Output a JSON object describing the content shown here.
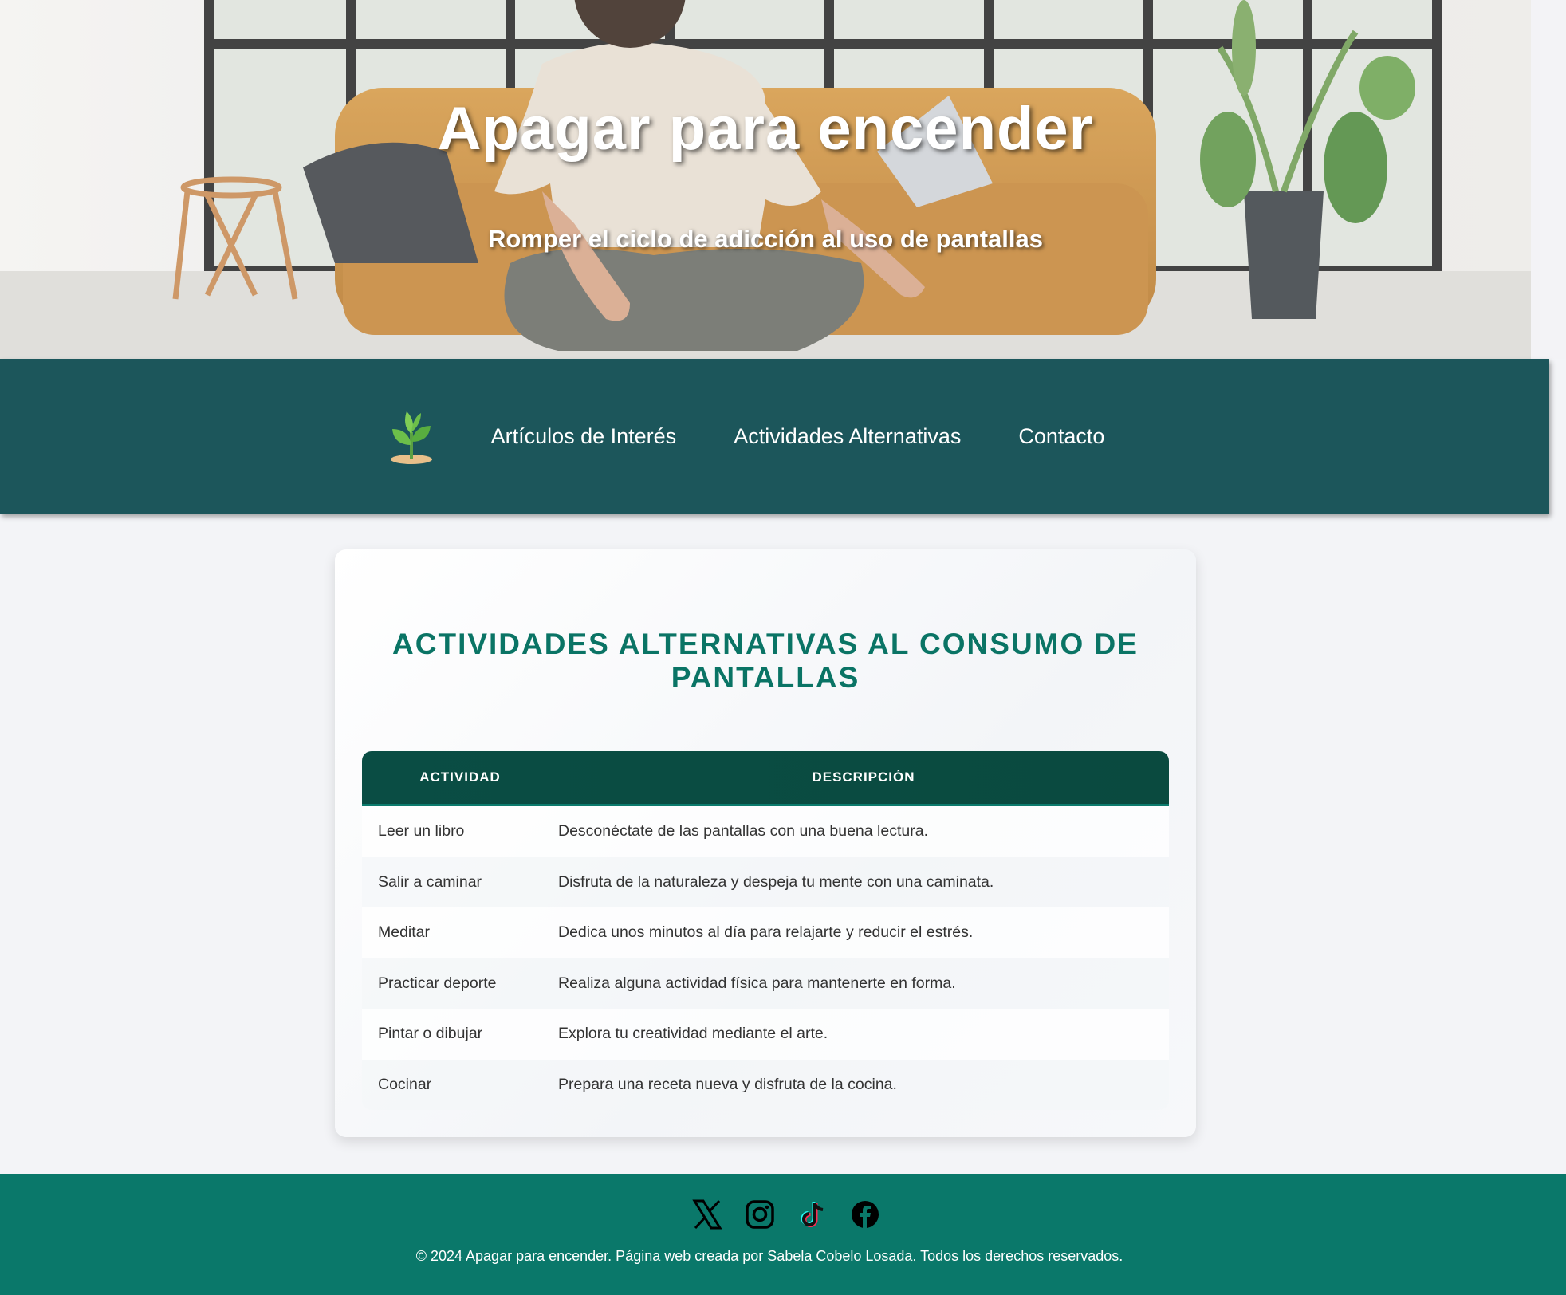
{
  "hero": {
    "title": "Apagar para encender",
    "subtitle": "Romper el ciclo de adicción al uso de pantallas"
  },
  "nav": {
    "logo_icon": "sprout-icon",
    "links": [
      "Artículos de Interés",
      "Actividades Alternativas",
      "Contacto"
    ]
  },
  "main": {
    "heading": "ACTIVIDADES ALTERNATIVAS AL CONSUMO DE PANTALLAS",
    "table": {
      "headers": [
        "ACTIVIDAD",
        "DESCRIPCIÓN"
      ],
      "rows": [
        {
          "activity": "Leer un libro",
          "description": "Desconéctate de las pantallas con una buena lectura."
        },
        {
          "activity": "Salir a caminar",
          "description": "Disfruta de la naturaleza y despeja tu mente con una caminata."
        },
        {
          "activity": "Meditar",
          "description": "Dedica unos minutos al día para relajarte y reducir el estrés."
        },
        {
          "activity": "Practicar deporte",
          "description": "Realiza alguna actividad física para mantenerte en forma."
        },
        {
          "activity": "Pintar o dibujar",
          "description": "Explora tu creatividad mediante el arte."
        },
        {
          "activity": "Cocinar",
          "description": "Prepara una receta nueva y disfruta de la cocina."
        }
      ]
    }
  },
  "footer": {
    "social_icons": [
      "x-icon",
      "instagram-icon",
      "tiktok-icon",
      "facebook-icon"
    ],
    "copyright": "© 2024 Apagar para encender. Página web creada por Sabela Cobelo Losada. Todos los derechos reservados."
  },
  "colors": {
    "nav_bg": "#1c565b",
    "heading": "#0a7465",
    "table_header": "#0a4d44",
    "footer_bg": "#0a786a"
  }
}
